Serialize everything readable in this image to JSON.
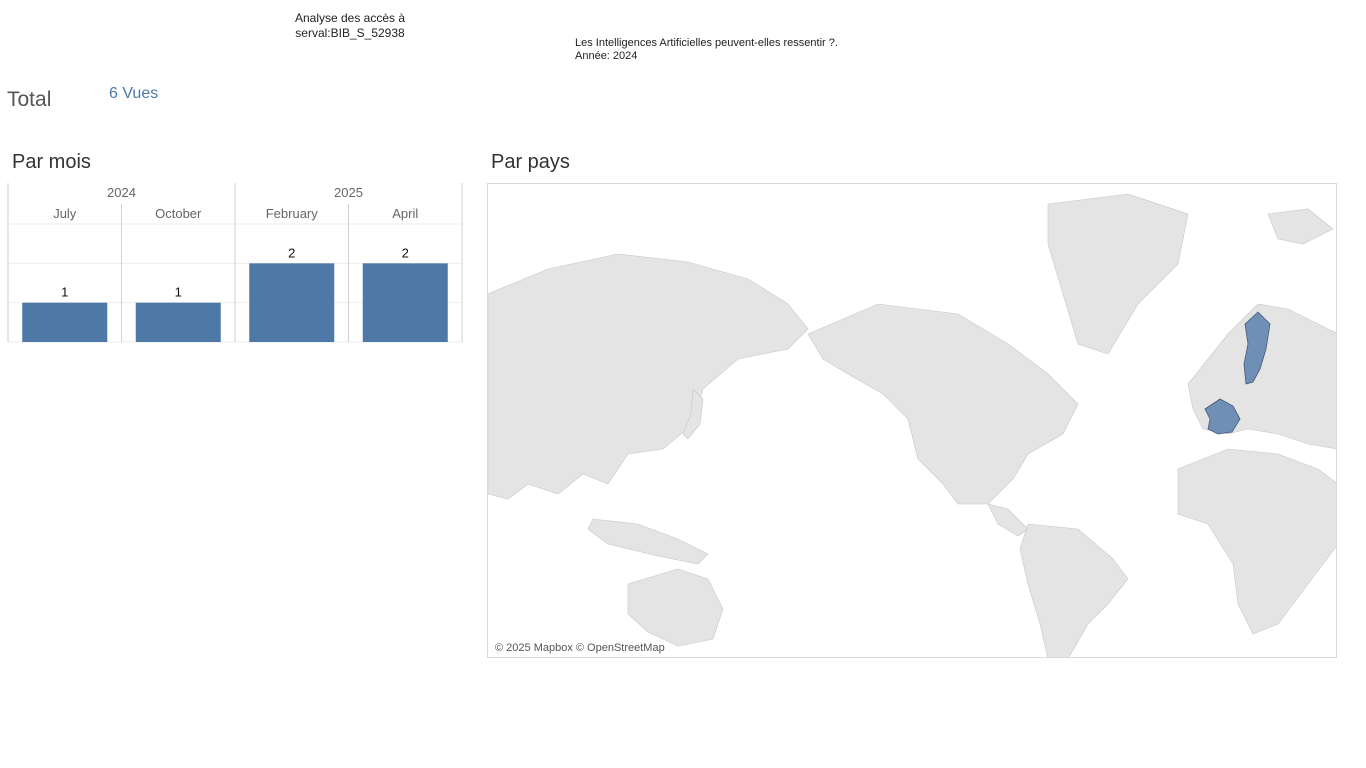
{
  "header": {
    "title_line1": "Analyse des accès à",
    "title_line2": "serval:BIB_S_52938",
    "doc_title": "Les Intelligences Artificielles peuvent-elles ressentir ?.",
    "doc_year": "Année: 2024"
  },
  "summary": {
    "total_label": "Total",
    "total_value": "6 Vues"
  },
  "sections": {
    "by_month": "Par mois",
    "by_country": "Par pays"
  },
  "chart_data": {
    "type": "bar",
    "years": [
      {
        "label": "2024",
        "months": [
          "July",
          "October"
        ]
      },
      {
        "label": "2025",
        "months": [
          "February",
          "April"
        ]
      }
    ],
    "categories": [
      "July",
      "October",
      "February",
      "April"
    ],
    "values": [
      1,
      1,
      2,
      2
    ],
    "ylim": [
      0,
      3
    ],
    "bar_color": "#4e79a7",
    "grid": true
  },
  "map": {
    "highlighted_countries": [
      "France",
      "Sweden"
    ],
    "highlight_color": "#6f8fb5",
    "land_color": "#e5e5e5",
    "credit": "© 2025 Mapbox © OpenStreetMap"
  }
}
